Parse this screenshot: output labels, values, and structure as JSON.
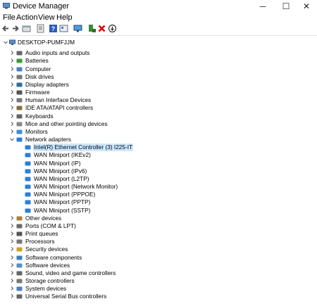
{
  "window": {
    "title": "Device Manager",
    "minimize": "─",
    "maximize": "☐",
    "close": "✕"
  },
  "menu": [
    "File",
    "Action",
    "View",
    "Help"
  ],
  "toolbar_icons": [
    "back-icon",
    "forward-icon",
    "properties-icon",
    "driver-icon",
    "help-icon",
    "update-icon",
    "monitor-icon",
    "add-device-icon",
    "uninstall-icon",
    "download-icon"
  ],
  "tree": {
    "root": "DESKTOP-PUMFJJM",
    "categories": [
      {
        "label": "Audio inputs and outputs",
        "icon": "speaker-icon"
      },
      {
        "label": "Batteries",
        "icon": "battery-icon"
      },
      {
        "label": "Computer",
        "icon": "computer-icon"
      },
      {
        "label": "Disk drives",
        "icon": "disk-icon"
      },
      {
        "label": "Display adapters",
        "icon": "display-icon"
      },
      {
        "label": "Firmware",
        "icon": "firmware-icon"
      },
      {
        "label": "Human Interface Devices",
        "icon": "hid-icon"
      },
      {
        "label": "IDE ATA/ATAPI controllers",
        "icon": "ide-icon"
      },
      {
        "label": "Keyboards",
        "icon": "keyboard-icon"
      },
      {
        "label": "Mice and other pointing devices",
        "icon": "mouse-icon"
      },
      {
        "label": "Monitors",
        "icon": "monitor-icon"
      },
      {
        "label": "Network adapters",
        "icon": "network-icon",
        "expanded": true,
        "children": [
          "Intel(R) Ethernet Controller (3) I225-IT",
          "WAN Miniport (IKEv2)",
          "WAN Miniport (IP)",
          "WAN Miniport (IPv6)",
          "WAN Miniport (L2TP)",
          "WAN Miniport (Network Monitor)",
          "WAN Miniport (PPPOE)",
          "WAN Miniport (PPTP)",
          "WAN Miniport (SSTP)"
        ]
      },
      {
        "label": "Other devices",
        "icon": "other-icon"
      },
      {
        "label": "Ports (COM & LPT)",
        "icon": "port-icon"
      },
      {
        "label": "Print queues",
        "icon": "printer-icon"
      },
      {
        "label": "Processors",
        "icon": "cpu-icon"
      },
      {
        "label": "Security devices",
        "icon": "security-icon"
      },
      {
        "label": "Software components",
        "icon": "component-icon"
      },
      {
        "label": "Software devices",
        "icon": "software-icon"
      },
      {
        "label": "Sound, video and game controllers",
        "icon": "sound-icon"
      },
      {
        "label": "Storage controllers",
        "icon": "storage-icon"
      },
      {
        "label": "System devices",
        "icon": "system-icon"
      },
      {
        "label": "Universal Serial Bus controllers",
        "icon": "usb-icon"
      }
    ],
    "selected_child": 0
  },
  "colors": {
    "selection": "#cce8ff",
    "accent": "#1e6fd0",
    "error_red": "#d80000"
  }
}
